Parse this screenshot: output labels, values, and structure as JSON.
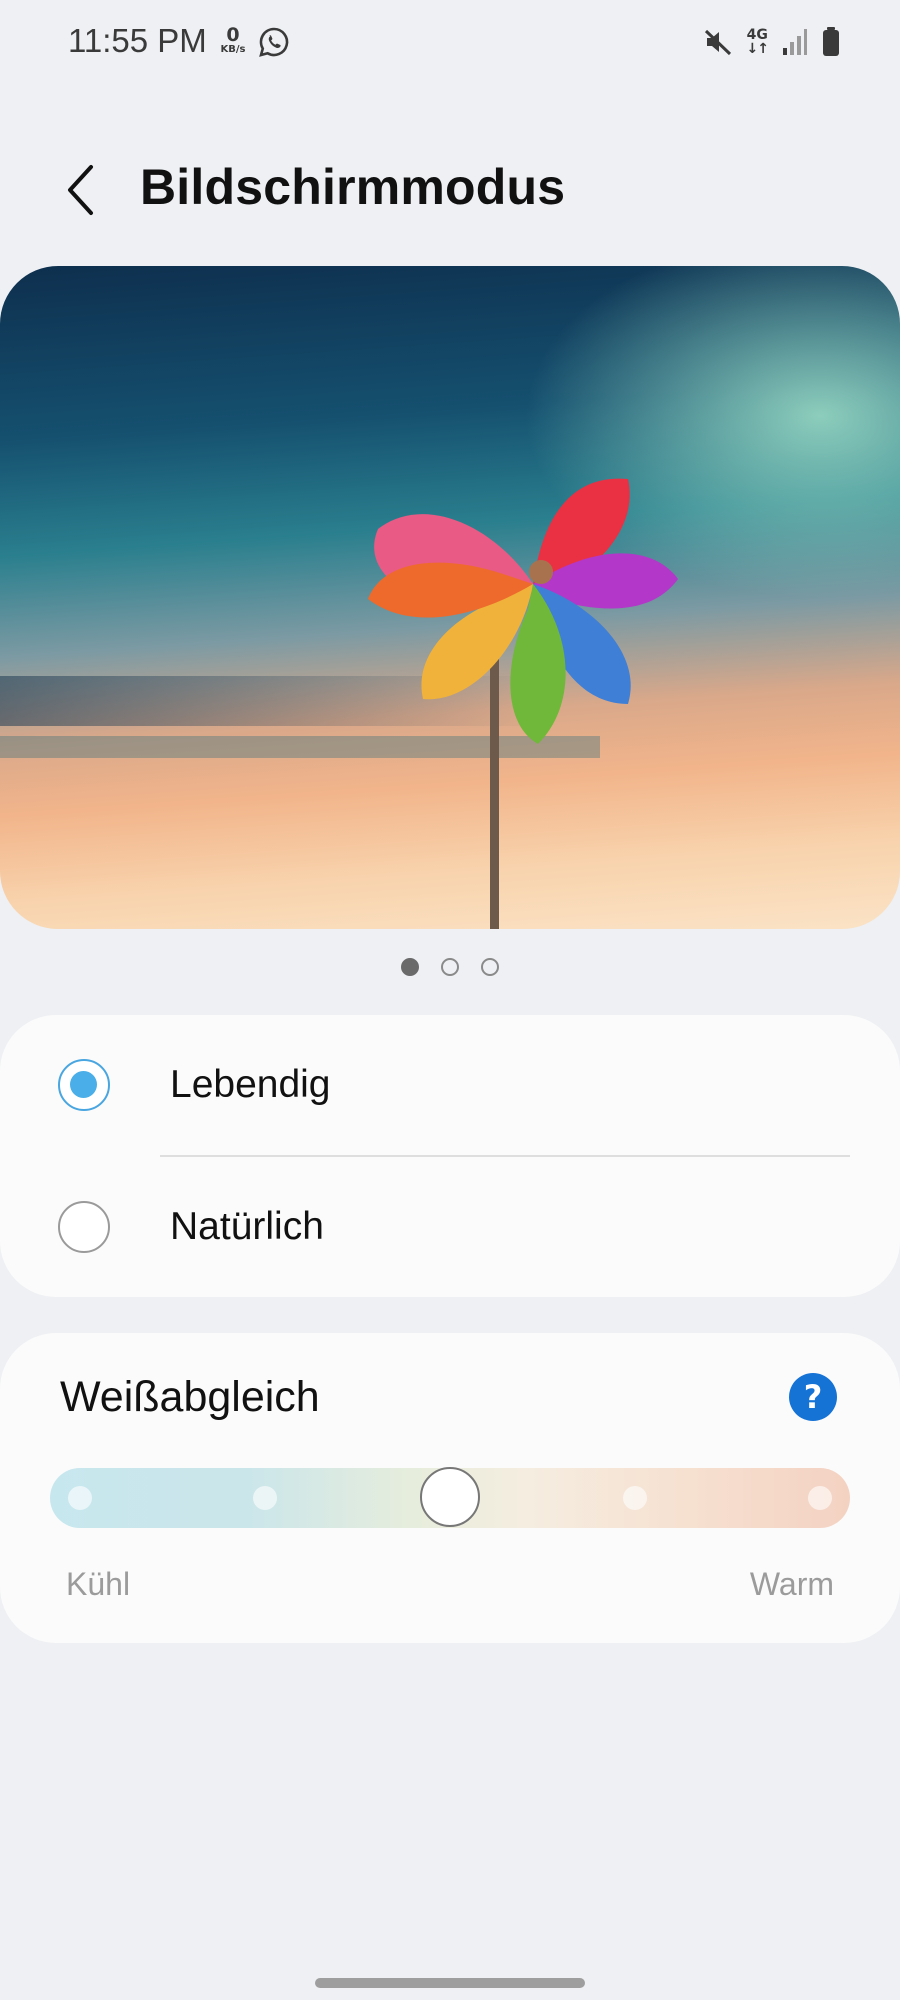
{
  "status_bar": {
    "time": "11:55 PM",
    "net_speed_value": "0",
    "net_speed_unit": "KB/s",
    "network_type": "4G",
    "icons": [
      "whatsapp-icon",
      "mute-icon",
      "network-4g-icon",
      "signal-icon",
      "battery-icon"
    ]
  },
  "header": {
    "title": "Bildschirmmodus",
    "back_icon": "chevron-left-icon"
  },
  "preview": {
    "image": "colorful-pinwheel-sky",
    "pages": 3,
    "active_page": 1
  },
  "modes": {
    "selected": "Lebendig",
    "options": [
      {
        "label": "Lebendig",
        "selected": true
      },
      {
        "label": "Natürlich",
        "selected": false
      }
    ]
  },
  "white_balance": {
    "title": "Weißabgleich",
    "help_label": "?",
    "min_label": "Kühl",
    "max_label": "Warm",
    "steps": 5,
    "value": 3
  },
  "colors": {
    "accent": "#4aaee8",
    "help_blue": "#1673d6",
    "background": "#eef0f3",
    "card": "#fbfbfb"
  }
}
